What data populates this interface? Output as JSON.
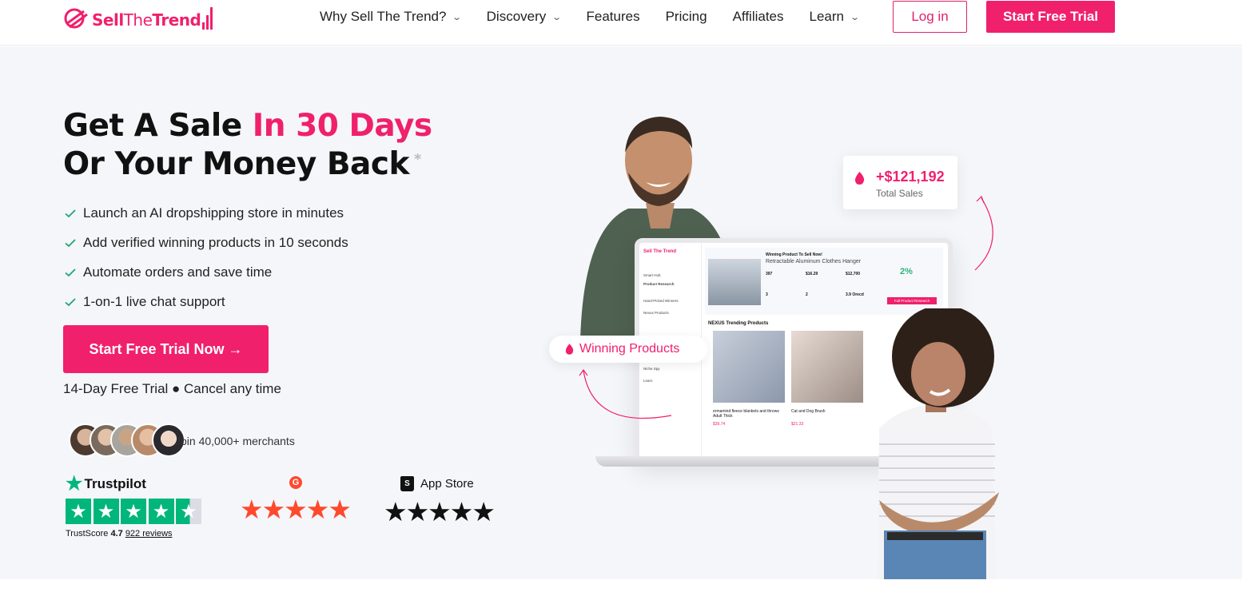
{
  "brand": {
    "logo_text_1": "Sell",
    "logo_text_2": "The",
    "logo_text_3": "Trend",
    "accent": "#f0206c"
  },
  "nav": {
    "items": [
      {
        "label": "Why Sell The Trend?",
        "has_dropdown": true
      },
      {
        "label": "Discovery",
        "has_dropdown": true
      },
      {
        "label": "Features",
        "has_dropdown": false
      },
      {
        "label": "Pricing",
        "has_dropdown": false
      },
      {
        "label": "Affiliates",
        "has_dropdown": false
      },
      {
        "label": "Learn",
        "has_dropdown": true
      }
    ],
    "login_label": "Log in",
    "trial_label": "Start Free Trial"
  },
  "hero": {
    "headline_1": "Get A Sale ",
    "headline_1_accent": "In 30 Days",
    "headline_2": "Or Your Money Back",
    "asterisk": "*",
    "bullets": [
      "Launch an AI dropshipping store in minutes",
      "Add verified winning products in 10 seconds",
      "Automate orders and save time",
      "1-on-1 live chat support"
    ],
    "cta_label": "Start Free Trial Now →",
    "trial_note": "14-Day Free Trial ● Cancel any time",
    "merchants_text": "Join 40,000+ merchants"
  },
  "ratings": {
    "trustpilot": {
      "name": "Trustpilot",
      "score_label": "TrustScore",
      "score": "4.7",
      "reviews": "922 reviews",
      "stars": 4.5
    },
    "g2": {
      "stars": 5
    },
    "app_store": {
      "name": "App Store",
      "stars": 5
    }
  },
  "illustration": {
    "total_sales_amount": "+$121,192",
    "total_sales_label": "Total Sales",
    "winning_products_label": "Winning Products",
    "dashboard": {
      "logo": "Sell The Trend",
      "banner_small": "Winning Product To Sell Now!",
      "banner_title": "Retractable Aluminum Clothes Hanger",
      "stats": [
        "397",
        "$16.29",
        "$12,700",
        "3",
        "2",
        "3.9 Orecd"
      ],
      "gauge": "2%",
      "research_button": "Full Product Research",
      "section_title": "NEXUS Trending Products",
      "sidebar": [
        "Smart Hub",
        "Product Research",
        "Hand-Picked Winners",
        "Nexus Products",
        "Store Intelligence",
        "Niche Spy",
        "Learn"
      ],
      "products": [
        {
          "name": "ermamind fleece blankets and throws Adult Thick",
          "price": "$39.74"
        },
        {
          "name": "Cat and Dog Brush",
          "price": "$21.33"
        }
      ]
    }
  }
}
